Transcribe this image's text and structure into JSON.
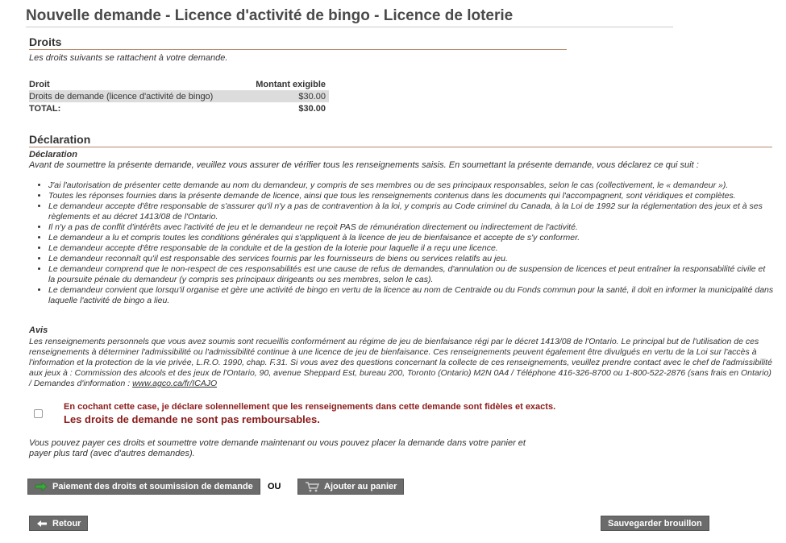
{
  "page": {
    "title": "Nouvelle demande - Licence d'activité de bingo - Licence de loterie"
  },
  "fees": {
    "heading": "Droits",
    "intro": "Les droits suivants se rattachent à votre demande.",
    "columns": [
      "Droit",
      "Montant exigible"
    ],
    "rows": [
      {
        "label": "Droits de demande (licence d'activité de bingo)",
        "amount": "$30.00"
      }
    ],
    "total_label": "TOTAL:",
    "total_amount": "$30.00"
  },
  "declaration": {
    "heading": "Déclaration",
    "subheading": "Déclaration",
    "intro": "Avant de soumettre la présente demande, veuillez vous assurer de vérifier tous les renseignements saisis. En soumettant la présente demande, vous déclarez ce qui suit :",
    "items": [
      "J'ai l'autorisation de présenter cette demande au nom du demandeur, y compris de ses membres ou de ses principaux responsables, selon le cas (collectivement, le « demandeur »).",
      "Toutes les réponses fournies dans la présente demande de licence, ainsi que tous les renseignements contenus dans les documents qui l'accompagnent, sont véridiques et complètes.",
      "Le demandeur accepte d'être responsable de s'assurer qu'il n'y a pas de contravention à la loi, y compris au Code criminel du Canada, à la Loi de 1992 sur la réglementation des jeux et à ses règlements et au décret 1413/08 de l'Ontario.",
      "Il n'y a pas de conflit d'intérêts avec l'activité de jeu et le demandeur ne reçoit PAS de rémunération directement ou indirectement de l'activité.",
      "Le demandeur a lu et compris toutes les conditions générales qui s'appliquent à la licence de jeu de bienfaisance et accepte de s'y conformer.",
      "Le demandeur accepte d'être responsable de la conduite et de la gestion de la loterie pour laquelle il a reçu une licence.",
      "Le demandeur reconnaît qu'il est responsable des services fournis par les fournisseurs de biens ou services relatifs au jeu.",
      "Le demandeur comprend que le non-respect de ces responsabilités est une cause de refus de demandes, d'annulation ou de suspension de licences et peut entraîner la responsabilité civile et la poursuite pénale du demandeur (y compris ses principaux dirigeants ou ses membres, selon le cas).",
      "Le demandeur convient que lorsqu'il organise et gère une activité de bingo en vertu de la licence au nom de Centraide ou du Fonds commun pour la santé, il doit en informer la municipalité dans laquelle l'activité de bingo a lieu."
    ]
  },
  "notice": {
    "heading": "Avis",
    "text": "Les renseignements personnels que vous avez soumis sont recueillis conformément au régime de jeu de bienfaisance régi par le décret 1413/08 de l'Ontario. Le principal but de l'utilisation de ces renseignements à déterminer l'admissibilité ou l'admissibilité continue à une licence de jeu de bienfaisance. Ces renseignements peuvent également être divulgués en vertu de la Loi sur l'accès à l'information et la protection de la vie privée, L.R.O. 1990, chap. F.31. Si vous avez des questions concernant la collecte de ces renseignements, veuillez prendre contact avec le chef de l'admissibilité aux jeux à : Commission des alcools et des jeux de l'Ontario, 90, avenue Sheppard Est, bureau 200, Toronto (Ontario) M2N 0A4 / Téléphone 416-326-8700 ou 1-800-522-2876 (sans frais en Ontario) / Demandes d'information : ",
    "link_text": "www.agco.ca/fr/ICAJO"
  },
  "confirmation": {
    "checkbox_label": "En cochant cette case, je déclare solennellement que les renseignements dans cette demande sont fidèles et exacts.",
    "warning": "Les droits de demande ne sont pas remboursables.",
    "color": "#8b1a1a"
  },
  "payment": {
    "info": "Vous pouvez payer ces droits et soumettre votre demande maintenant ou vous pouvez placer la demande dans votre panier et payer plus tard (avec d'autres demandes).",
    "pay_button": "Paiement des droits et soumission de demande",
    "pay_icon": "arrow-right-icon",
    "or_label": "OU",
    "cart_button": "Ajouter au panier",
    "cart_icon": "cart-icon"
  },
  "footer": {
    "back_button": "Retour",
    "back_icon": "arrow-left-icon",
    "save_button": "Sauvegarder brouillon"
  },
  "colors": {
    "button_bg": "#6b6b6b",
    "section_rule": "#b5876a",
    "arrow_green": "#3aa83a"
  }
}
